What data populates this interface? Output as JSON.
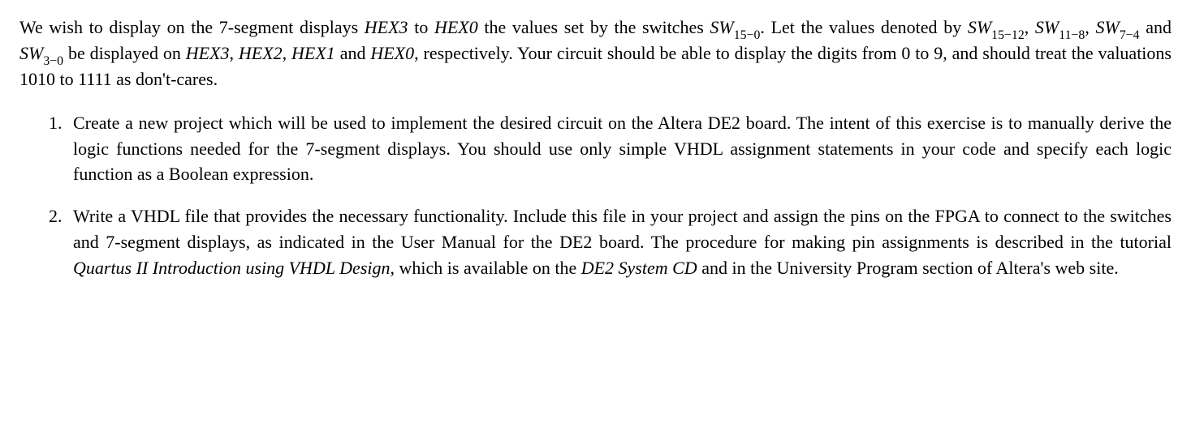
{
  "intro": {
    "p1a": "We wish to display on the 7-segment displays ",
    "hex3": "HEX3",
    "to1": " to ",
    "hex0": "HEX0",
    "p1b": " the values set by the switches ",
    "sw": "SW",
    "sub15_0": "15−0",
    "p1c": ". Let the values denoted by ",
    "sub15_12": "15−12",
    "comma1": ", ",
    "sub11_8": "11−8",
    "comma2": ", ",
    "sub7_4": "7−4",
    "and1": " and ",
    "sub3_0": "3−0",
    "p1d": " be displayed on ",
    "hex3b": "HEX3",
    "comma3": ", ",
    "hex2": "HEX2",
    "comma4": ", ",
    "hex1": "HEX1",
    "and2": " and ",
    "hex0b": "HEX0",
    "p1e": ", respectively. Your circuit should be able to display the digits from 0 to 9, and should treat the valuations 1010 to 1111 as don't-cares."
  },
  "items": {
    "li1": "Create a new project which will be used to implement the desired circuit on the Altera DE2 board. The intent of this exercise is to manually derive the logic functions needed for the 7-segment displays. You should use only simple VHDL assignment statements in your code and specify each logic function as a Boolean expression.",
    "li2a": "Write a VHDL file that provides the necessary functionality. Include this file in your project and assign the pins on the FPGA to connect to the switches and 7-segment displays, as indicated in the User Manual for the DE2 board. The procedure for making pin assignments is described in the tutorial ",
    "li2_ital1": "Quartus II Introduction using VHDL Design",
    "li2b": ", which is available on the ",
    "li2_ital2": "DE2 System CD",
    "li2c": " and in the University Program section of Altera's web site."
  }
}
